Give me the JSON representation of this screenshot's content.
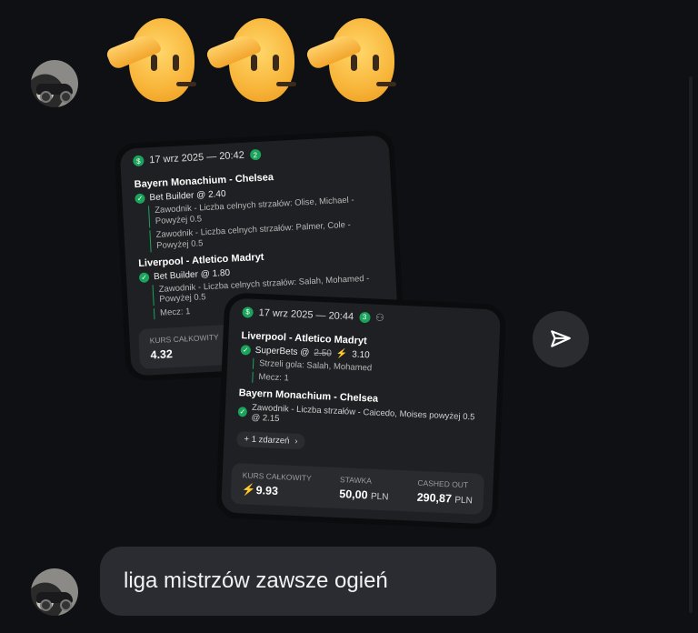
{
  "messages": {
    "emoji": [
      "🫡",
      "🫡",
      "🫡"
    ],
    "text": "liga mistrzów zawsze ogień"
  },
  "card_back": {
    "date": "17 wrz 2025 — 20:42",
    "count": "2",
    "matches": [
      {
        "title": "Bayern Monachium - Chelsea",
        "bet": "Bet Builder @ 2.40",
        "legs": [
          "Zawodnik - Liczba celnych strzałów: Olise, Michael - Powyżej 0.5",
          "Zawodnik - Liczba celnych strzałów: Palmer, Cole - Powyżej 0.5"
        ]
      },
      {
        "title": "Liverpool - Atletico Madryt",
        "bet": "Bet Builder @ 1.80",
        "legs": [
          "Zawodnik - Liczba celnych strzałów: Salah, Mohamed - Powyżej 0.5",
          "Mecz: 1"
        ]
      }
    ],
    "total_label": "KURS CAŁKOWITY",
    "total_value": "4.32"
  },
  "card_front": {
    "date": "17 wrz 2025 — 20:44",
    "count": "3",
    "m1_title": "Liverpool - Atletico Madryt",
    "m1_bet": "SuperBets @",
    "m1_old": "2.50",
    "m1_new": "3.10",
    "m1_leg1": "Strzeli gola: Salah, Mohamed",
    "m1_leg2": "Mecz: 1",
    "m2_title": "Bayern Monachium - Chelsea",
    "m2_leg": "Zawodnik - Liczba strzałów - Caicedo, Moises powyżej 0.5 @ 2.15",
    "more": "+ 1 zdarzeń",
    "total_label": "KURS CAŁKOWITY",
    "total_value": "9.93",
    "stake_label": "STAWKA",
    "stake_value": "50,00",
    "stake_cur": "PLN",
    "cashout_label": "CASHED OUT",
    "cashout_value": "290,87",
    "cashout_cur": "PLN"
  },
  "icons": {
    "send": "paper-plane-icon"
  }
}
